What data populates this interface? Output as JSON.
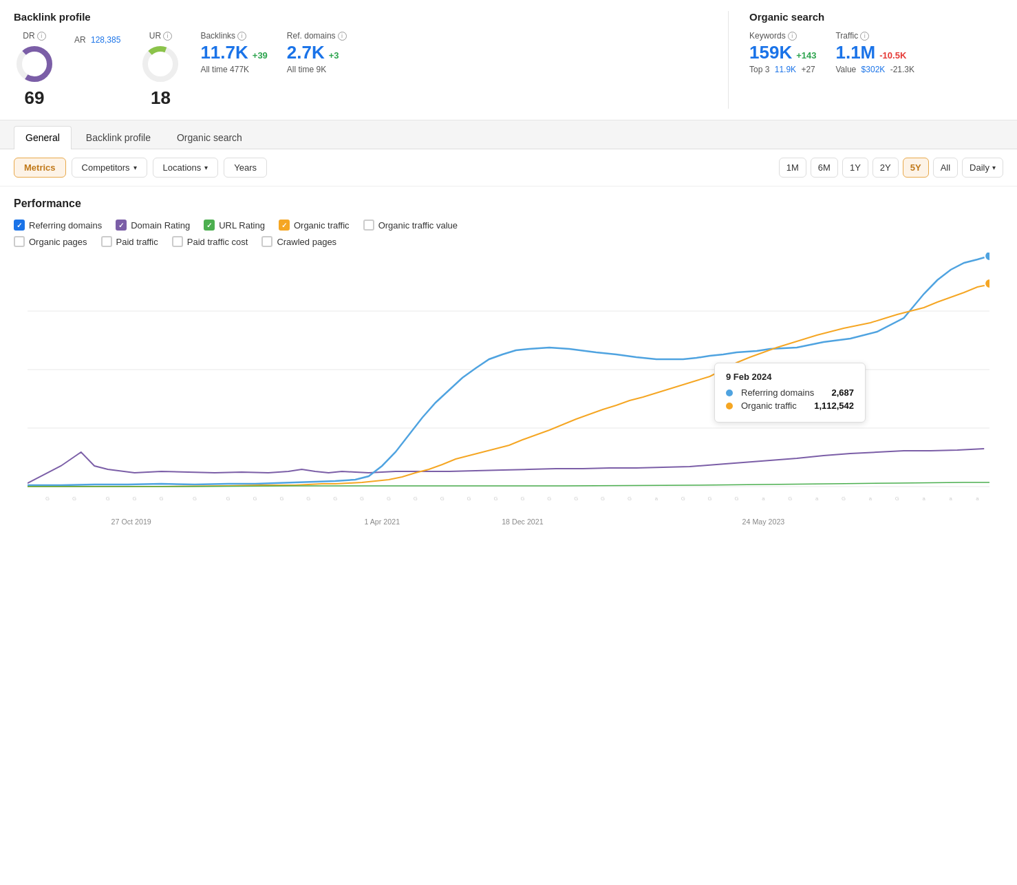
{
  "header": {
    "backlink_profile": {
      "title": "Backlink profile",
      "dr_label": "DR",
      "dr_value": "69",
      "ur_label": "UR",
      "ur_value": "18",
      "ar_label": "AR",
      "ar_value": "128,385",
      "backlinks_label": "Backlinks",
      "backlinks_value": "11.7K",
      "backlinks_change": "+39",
      "backlinks_sub": "All time  477K",
      "ref_domains_label": "Ref. domains",
      "ref_domains_value": "2.7K",
      "ref_domains_change": "+3",
      "ref_domains_sub": "All time  9K"
    },
    "organic_search": {
      "title": "Organic search",
      "keywords_label": "Keywords",
      "keywords_value": "159K",
      "keywords_change": "+143",
      "keywords_sub_label": "Top 3",
      "keywords_sub_value": "11.9K",
      "keywords_sub_change": "+27",
      "traffic_label": "Traffic",
      "traffic_value": "1.1M",
      "traffic_change": "-10.5K",
      "traffic_sub_label": "Value",
      "traffic_sub_value": "$302K",
      "traffic_sub_change": "-21.3K"
    }
  },
  "tabs": [
    {
      "label": "General",
      "active": true
    },
    {
      "label": "Backlink profile",
      "active": false
    },
    {
      "label": "Organic search",
      "active": false
    }
  ],
  "toolbar": {
    "metrics_label": "Metrics",
    "competitors_label": "Competitors",
    "locations_label": "Locations",
    "years_label": "Years",
    "time_buttons": [
      "1M",
      "6M",
      "1Y",
      "2Y",
      "5Y",
      "All"
    ],
    "active_time": "5Y",
    "granularity_label": "Daily"
  },
  "performance": {
    "title": "Performance",
    "checkboxes": [
      {
        "label": "Referring domains",
        "color": "blue",
        "checked": true
      },
      {
        "label": "Domain Rating",
        "color": "purple",
        "checked": true
      },
      {
        "label": "URL Rating",
        "color": "green",
        "checked": true
      },
      {
        "label": "Organic traffic",
        "color": "orange",
        "checked": true
      },
      {
        "label": "Organic traffic value",
        "color": "unchecked",
        "checked": false
      }
    ],
    "checkboxes_row2": [
      {
        "label": "Organic pages",
        "color": "unchecked",
        "checked": false
      },
      {
        "label": "Paid traffic",
        "color": "unchecked",
        "checked": false
      },
      {
        "label": "Paid traffic cost",
        "color": "unchecked",
        "checked": false
      },
      {
        "label": "Crawled pages",
        "color": "unchecked",
        "checked": false
      }
    ]
  },
  "tooltip": {
    "date": "9 Feb 2024",
    "rows": [
      {
        "color": "#4fa3e0",
        "label": "Referring domains",
        "value": "2,687"
      },
      {
        "color": "#f5a623",
        "label": "Organic traffic",
        "value": "1,112,542"
      }
    ]
  },
  "x_axis_labels": [
    "27 Oct 2019",
    "1 Apr 2021",
    "18 Dec 2021",
    "24 May 2023"
  ]
}
